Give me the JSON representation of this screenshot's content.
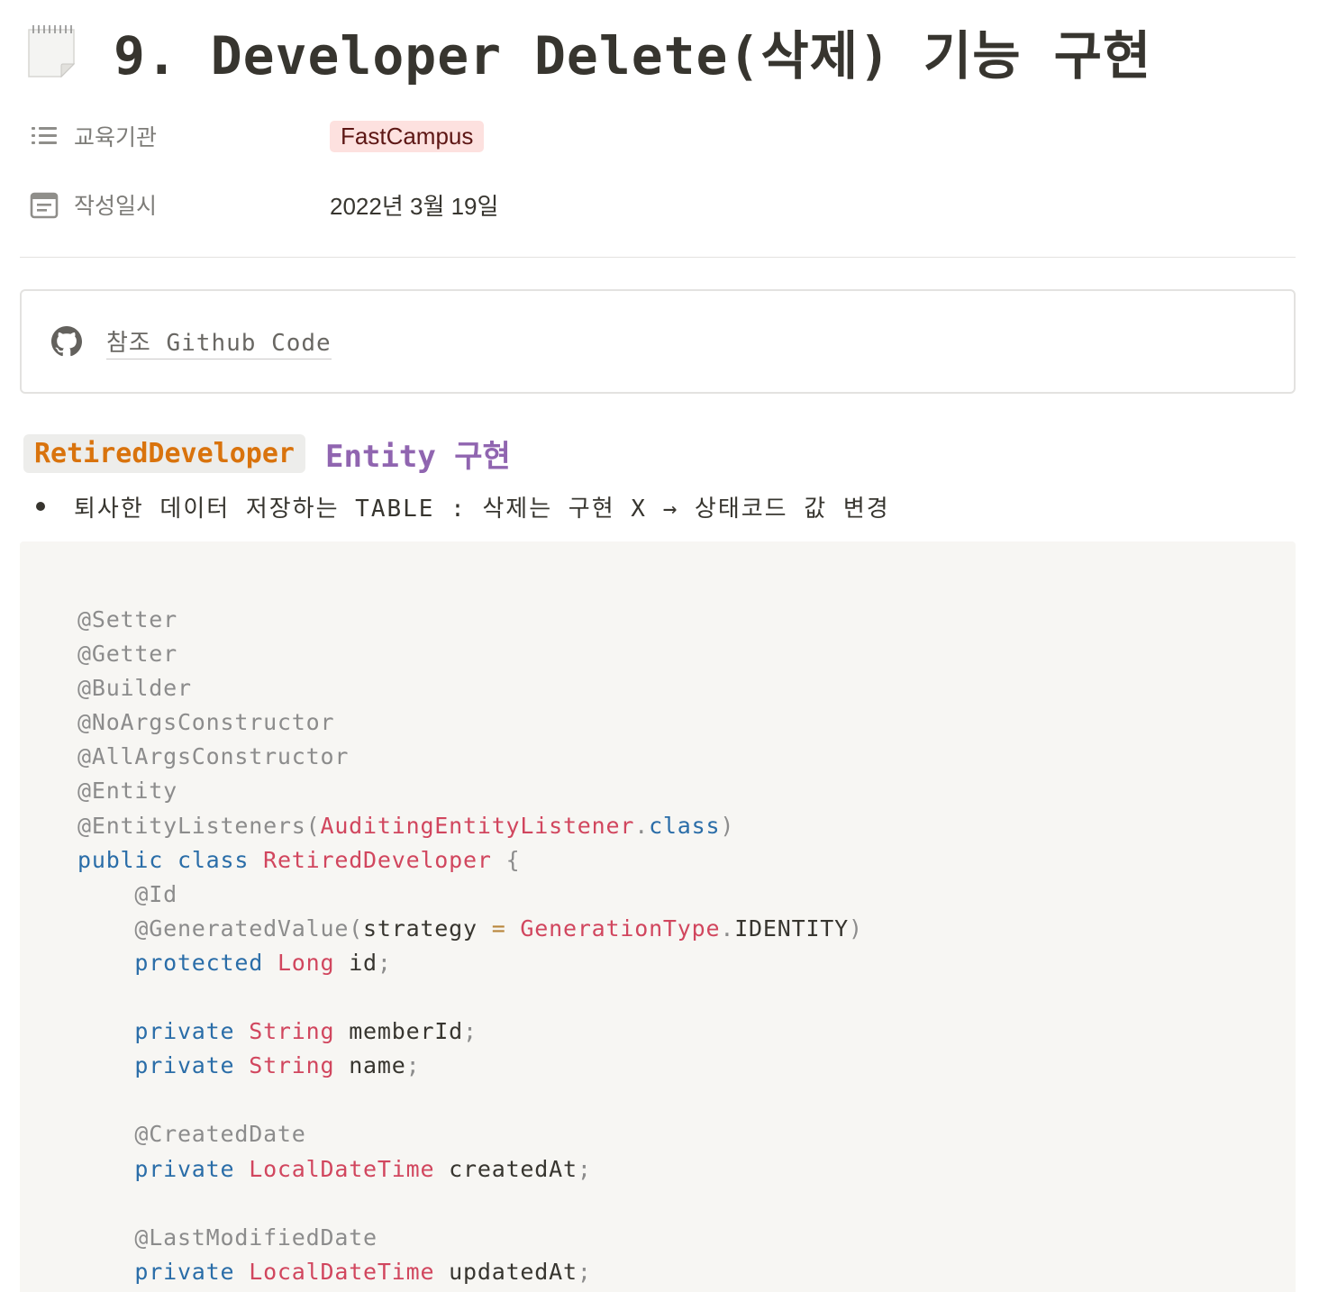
{
  "page": {
    "title": "9. Developer Delete(삭제) 기능 구현",
    "icon": "notepad-icon"
  },
  "properties": {
    "institution": {
      "label": "교육기관",
      "icon": "list-icon",
      "value": "FastCampus"
    },
    "created": {
      "label": "작성일시",
      "icon": "calendar-icon",
      "value": "2022년 3월 19일"
    }
  },
  "bookmark": {
    "icon": "github-icon",
    "text": "참조 Github Code"
  },
  "section": {
    "inline_code": "RetiredDeveloper",
    "heading_rest": "Entity 구현",
    "bullet": "퇴사한 데이터 저장하는 TABLE : 삭제는 구현 X → 상태코드 값 변경"
  },
  "colors": {
    "tag_bg": "#fde1df",
    "tag_text": "#5d1715",
    "heading_purple": "#9065b0",
    "inline_code_orange": "#d9730d",
    "code_bg": "#f7f6f3",
    "code_keyword": "#2a6da8",
    "code_type": "#d1465e",
    "code_annotation": "#8c8c8c"
  },
  "code": {
    "lines": [
      [
        {
          "t": "@Setter",
          "c": "ann"
        }
      ],
      [
        {
          "t": "@Getter",
          "c": "ann"
        }
      ],
      [
        {
          "t": "@Builder",
          "c": "ann"
        }
      ],
      [
        {
          "t": "@NoArgsConstructor",
          "c": "ann"
        }
      ],
      [
        {
          "t": "@AllArgsConstructor",
          "c": "ann"
        }
      ],
      [
        {
          "t": "@Entity",
          "c": "ann"
        }
      ],
      [
        {
          "t": "@EntityListeners(",
          "c": "ann"
        },
        {
          "t": "AuditingEntityListener",
          "c": "ty"
        },
        {
          "t": ".",
          "c": "pn"
        },
        {
          "t": "class",
          "c": "kw"
        },
        {
          "t": ")",
          "c": "pn"
        }
      ],
      [
        {
          "t": "public",
          "c": "kw"
        },
        {
          "t": " ",
          "c": "tx"
        },
        {
          "t": "class",
          "c": "kw"
        },
        {
          "t": " ",
          "c": "tx"
        },
        {
          "t": "RetiredDeveloper",
          "c": "ty"
        },
        {
          "t": " {",
          "c": "pn"
        }
      ],
      [
        {
          "t": "    ",
          "c": "tx"
        },
        {
          "t": "@Id",
          "c": "ann"
        }
      ],
      [
        {
          "t": "    ",
          "c": "tx"
        },
        {
          "t": "@GeneratedValue(",
          "c": "ann"
        },
        {
          "t": "strategy ",
          "c": "tx"
        },
        {
          "t": "=",
          "c": "op"
        },
        {
          "t": " ",
          "c": "tx"
        },
        {
          "t": "GenerationType",
          "c": "ty"
        },
        {
          "t": ".",
          "c": "pn"
        },
        {
          "t": "IDENTITY",
          "c": "tx"
        },
        {
          "t": ")",
          "c": "pn"
        }
      ],
      [
        {
          "t": "    ",
          "c": "tx"
        },
        {
          "t": "protected",
          "c": "kw"
        },
        {
          "t": " ",
          "c": "tx"
        },
        {
          "t": "Long",
          "c": "ty"
        },
        {
          "t": " id",
          "c": "tx"
        },
        {
          "t": ";",
          "c": "pn"
        }
      ],
      [
        {
          "t": "",
          "c": "tx"
        }
      ],
      [
        {
          "t": "    ",
          "c": "tx"
        },
        {
          "t": "private",
          "c": "kw"
        },
        {
          "t": " ",
          "c": "tx"
        },
        {
          "t": "String",
          "c": "ty"
        },
        {
          "t": " memberId",
          "c": "tx"
        },
        {
          "t": ";",
          "c": "pn"
        }
      ],
      [
        {
          "t": "    ",
          "c": "tx"
        },
        {
          "t": "private",
          "c": "kw"
        },
        {
          "t": " ",
          "c": "tx"
        },
        {
          "t": "String",
          "c": "ty"
        },
        {
          "t": " name",
          "c": "tx"
        },
        {
          "t": ";",
          "c": "pn"
        }
      ],
      [
        {
          "t": "",
          "c": "tx"
        }
      ],
      [
        {
          "t": "    ",
          "c": "tx"
        },
        {
          "t": "@CreatedDate",
          "c": "ann"
        }
      ],
      [
        {
          "t": "    ",
          "c": "tx"
        },
        {
          "t": "private",
          "c": "kw"
        },
        {
          "t": " ",
          "c": "tx"
        },
        {
          "t": "LocalDateTime",
          "c": "ty"
        },
        {
          "t": " createdAt",
          "c": "tx"
        },
        {
          "t": ";",
          "c": "pn"
        }
      ],
      [
        {
          "t": "",
          "c": "tx"
        }
      ],
      [
        {
          "t": "    ",
          "c": "tx"
        },
        {
          "t": "@LastModifiedDate",
          "c": "ann"
        }
      ],
      [
        {
          "t": "    ",
          "c": "tx"
        },
        {
          "t": "private",
          "c": "kw"
        },
        {
          "t": " ",
          "c": "tx"
        },
        {
          "t": "LocalDateTime",
          "c": "ty"
        },
        {
          "t": " updatedAt",
          "c": "tx"
        },
        {
          "t": ";",
          "c": "pn"
        }
      ]
    ]
  }
}
